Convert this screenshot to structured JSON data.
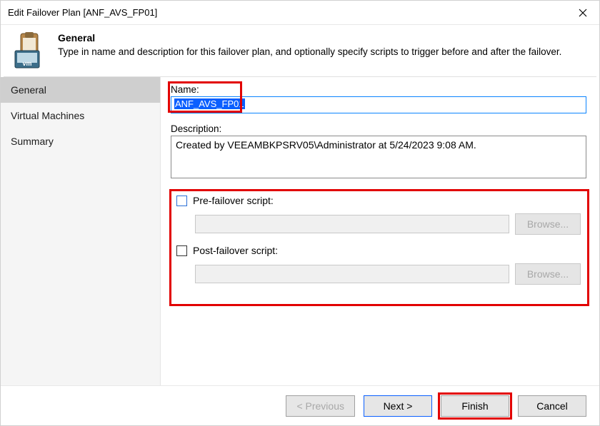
{
  "window": {
    "title": "Edit Failover Plan [ANF_AVS_FP01]"
  },
  "header": {
    "heading": "General",
    "subheading": "Type in name and description for this failover plan, and optionally specify scripts to trigger before and after the failover."
  },
  "sidebar": {
    "items": [
      {
        "label": "General",
        "active": true
      },
      {
        "label": "Virtual Machines",
        "active": false
      },
      {
        "label": "Summary",
        "active": false
      }
    ]
  },
  "form": {
    "name_label": "Name:",
    "name_value": "ANF_AVS_FP01",
    "description_label": "Description:",
    "description_value": "Created by VEEAMBKPSRV05\\Administrator at 5/24/2023 9:08 AM.",
    "pre_script_label": "Pre-failover script:",
    "pre_script_path": "",
    "post_script_label": "Post-failover script:",
    "post_script_path": "",
    "browse_label": "Browse..."
  },
  "footer": {
    "previous": "< Previous",
    "next": "Next >",
    "finish": "Finish",
    "cancel": "Cancel"
  }
}
